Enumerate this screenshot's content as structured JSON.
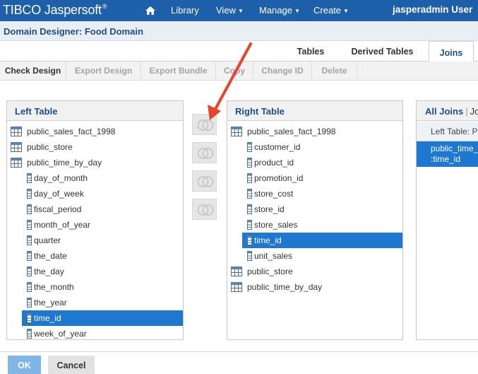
{
  "brand": {
    "name": "TIBCO Jaspersoft",
    "trademark": "®"
  },
  "nav": {
    "home_icon": "home-icon",
    "items": [
      {
        "label": "Library",
        "has_menu": false
      },
      {
        "label": "View",
        "has_menu": true
      },
      {
        "label": "Manage",
        "has_menu": true
      },
      {
        "label": "Create",
        "has_menu": true
      }
    ],
    "user": "jasperadmin User"
  },
  "page_title": "Domain Designer: Food Domain",
  "tabs": [
    {
      "label": "Tables",
      "active": false
    },
    {
      "label": "Derived Tables",
      "active": false
    },
    {
      "label": "Joins",
      "active": true
    }
  ],
  "actions": [
    {
      "label": "Check Design",
      "enabled": true
    },
    {
      "label": "Export Design",
      "enabled": false
    },
    {
      "label": "Export Bundle",
      "enabled": false
    },
    {
      "label": "Copy",
      "enabled": false
    },
    {
      "label": "Change ID",
      "enabled": false
    },
    {
      "label": "Delete",
      "enabled": false
    }
  ],
  "left_table": {
    "header": "Left Table",
    "rows": [
      {
        "label": "public_sales_fact_1998",
        "type": "table",
        "expanded": false
      },
      {
        "label": "public_store",
        "type": "table",
        "expanded": false
      },
      {
        "label": "public_time_by_day",
        "type": "table",
        "expanded": true
      },
      {
        "label": "day_of_month",
        "type": "column"
      },
      {
        "label": "day_of_week",
        "type": "column"
      },
      {
        "label": "fiscal_period",
        "type": "column"
      },
      {
        "label": "month_of_year",
        "type": "column"
      },
      {
        "label": "quarter",
        "type": "column"
      },
      {
        "label": "the_date",
        "type": "column"
      },
      {
        "label": "the_day",
        "type": "column"
      },
      {
        "label": "the_month",
        "type": "column"
      },
      {
        "label": "the_year",
        "type": "column"
      },
      {
        "label": "time_id",
        "type": "column",
        "selected": true
      },
      {
        "label": "week_of_year",
        "type": "column"
      }
    ]
  },
  "join_buttons": [
    {
      "icon": "inner-join-icon"
    },
    {
      "icon": "left-outer-join-icon"
    },
    {
      "icon": "right-outer-join-icon"
    },
    {
      "icon": "full-outer-join-icon"
    }
  ],
  "right_table": {
    "header": "Right Table",
    "rows": [
      {
        "label": "public_sales_fact_1998",
        "type": "table",
        "expanded": true
      },
      {
        "label": "customer_id",
        "type": "column"
      },
      {
        "label": "product_id",
        "type": "column"
      },
      {
        "label": "promotion_id",
        "type": "column"
      },
      {
        "label": "store_cost",
        "type": "column"
      },
      {
        "label": "store_id",
        "type": "column"
      },
      {
        "label": "store_sales",
        "type": "column"
      },
      {
        "label": "time_id",
        "type": "column",
        "selected": true
      },
      {
        "label": "unit_sales",
        "type": "column"
      },
      {
        "label": "public_store",
        "type": "table",
        "expanded": false
      },
      {
        "label": "public_time_by_day",
        "type": "table",
        "expanded": false
      }
    ]
  },
  "all_joins": {
    "header": "All Joins",
    "header_sep": "|",
    "header_next": "Jo",
    "sub_label": "Left Table: P",
    "item_line1": "public_time_",
    "item_line2": ":time_id"
  },
  "footer": {
    "ok_label": "OK",
    "cancel_label": "Cancel"
  },
  "colors": {
    "nav_bg": "#1d5fa8",
    "selection": "#1e78d0",
    "title_text": "#1d4f86",
    "arrow": "#e8432c"
  }
}
